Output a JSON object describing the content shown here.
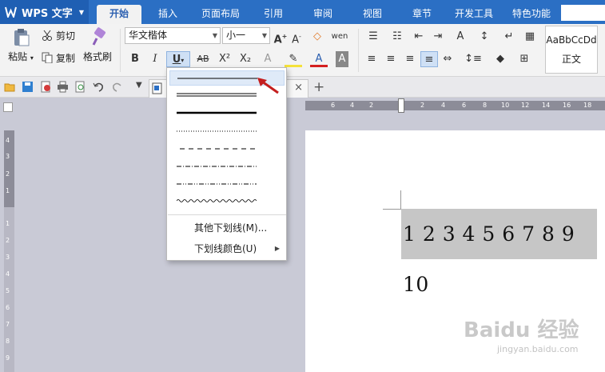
{
  "app": {
    "title": "WPS 文字"
  },
  "tabs": [
    {
      "label": "开始",
      "active": true
    },
    {
      "label": "插入"
    },
    {
      "label": "页面布局"
    },
    {
      "label": "引用"
    },
    {
      "label": "审阅"
    },
    {
      "label": "视图"
    },
    {
      "label": "章节"
    },
    {
      "label": "开发工具"
    },
    {
      "label": "特色功能"
    }
  ],
  "ribbon": {
    "paste": "粘贴",
    "cut": "剪切",
    "copy": "复制",
    "format_painter": "格式刷",
    "font_name": "华文楷体",
    "font_size": "小一",
    "bold": "B",
    "italic": "I",
    "underline": "U",
    "strikethrough": "AB",
    "superscript": "X²",
    "subscript": "X₂",
    "style_preview": "AaBbCcDd",
    "style_name": "正文"
  },
  "document": {
    "content": "1 2 3 4 5 6 7 8 9 10"
  },
  "ruler": {
    "h_numbers": [
      "6",
      "4",
      "2",
      "",
      "2",
      "4",
      "6",
      "8",
      "10",
      "12",
      "14",
      "16",
      "18"
    ],
    "v_numbers": [
      "4",
      "3",
      "2",
      "1",
      "",
      "1",
      "2",
      "3",
      "4",
      "5",
      "6",
      "7",
      "8",
      "9"
    ]
  },
  "underline_menu": {
    "styles": [
      "single",
      "double",
      "thick",
      "dotted",
      "dashed",
      "dash-dot",
      "dash-dot-dot",
      "wave"
    ],
    "more": "其他下划线(M)...",
    "color": "下划线颜色(U)"
  },
  "watermark": {
    "text": "Baidu 经验",
    "sub": "jingyan.baidu.com"
  },
  "colors": {
    "tabbar": "#2b6fc4",
    "accent": "#2b5fb0",
    "arrow": "#d42020"
  }
}
